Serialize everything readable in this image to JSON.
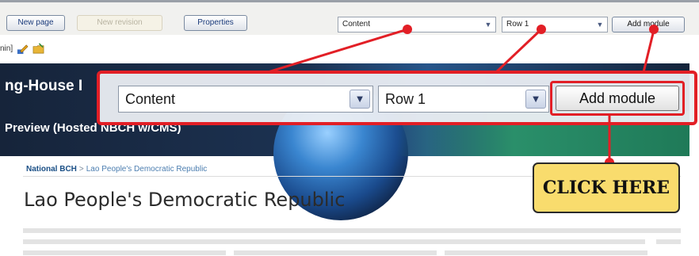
{
  "toolbar": {
    "new_page": "New page",
    "new_revision": "New revision",
    "properties": "Properties",
    "content_select": "Content",
    "row_select": "Row 1",
    "add_module": "Add module"
  },
  "admin_text": "nin]",
  "banner": {
    "title": "ng-House I",
    "subtitle": "Preview (Hosted NBCH w/CMS)"
  },
  "callout": {
    "content_select": "Content",
    "row_select": "Row 1",
    "add_module": "Add module"
  },
  "breadcrumb": {
    "home": "National BCH",
    "separator": ">",
    "current": "Lao People's Democratic Republic"
  },
  "page_title": "Lao People's Democratic Republic",
  "annotation": {
    "click_here": "CLICK HERE",
    "highlight_color": "#e21f26",
    "note_color": "#f9dc6d"
  }
}
